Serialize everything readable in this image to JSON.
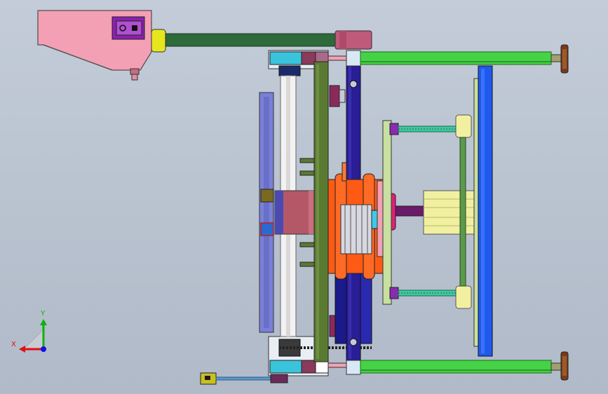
{
  "viewport": {
    "background_top": "#c3ccd8",
    "background_bottom": "#b0bac8"
  },
  "triad": {
    "x_label": "X",
    "y_label": "Y",
    "x_color": "#e01010",
    "y_color": "#10b010",
    "z_color": "#1010e0"
  },
  "parts": {
    "control_box_color": "#f4a0b4",
    "panel_color": "#8a20b0",
    "frame_green": "#46d246",
    "frame_olive": "#5a7a32",
    "frame_navy": "#2a1e96",
    "plate_blue": "#1e5aee",
    "roller_color": "#f2f2f2",
    "motor_orange": "#ff5a14",
    "cylinder_yellow": "#f0f0a0",
    "leadscrew_color": "#40c8a0"
  }
}
